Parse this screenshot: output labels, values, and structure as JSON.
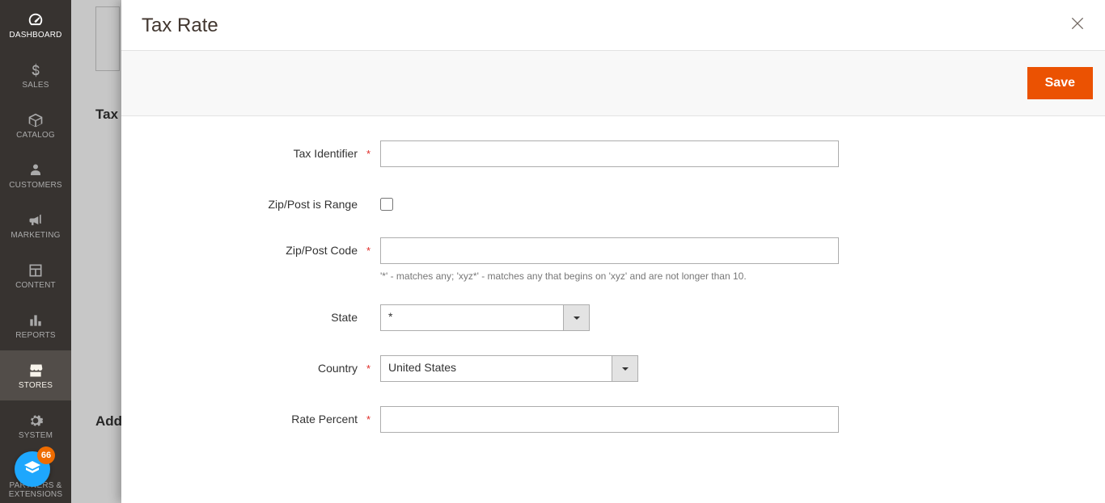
{
  "sidebar": {
    "items": [
      {
        "label": "DASHBOARD"
      },
      {
        "label": "SALES"
      },
      {
        "label": "CATALOG"
      },
      {
        "label": "CUSTOMERS"
      },
      {
        "label": "MARKETING"
      },
      {
        "label": "CONTENT"
      },
      {
        "label": "REPORTS"
      },
      {
        "label": "STORES"
      },
      {
        "label": "SYSTEM"
      },
      {
        "label": "FIND PARTNERS & EXTENSIONS"
      }
    ]
  },
  "background": {
    "title1": "Tax",
    "title2": "Add"
  },
  "modal": {
    "title": "Tax Rate",
    "save_label": "Save",
    "fields": {
      "tax_identifier": {
        "label": "Tax Identifier",
        "value": ""
      },
      "zip_is_range": {
        "label": "Zip/Post is Range",
        "checked": false
      },
      "zip_code": {
        "label": "Zip/Post Code",
        "value": "",
        "note": "'*' - matches any; 'xyz*' - matches any that begins on 'xyz' and are not longer than 10."
      },
      "state": {
        "label": "State",
        "value": "*"
      },
      "country": {
        "label": "Country",
        "value": "United States"
      },
      "rate_percent": {
        "label": "Rate Percent",
        "value": ""
      }
    }
  },
  "help_badge": {
    "count": "66"
  }
}
